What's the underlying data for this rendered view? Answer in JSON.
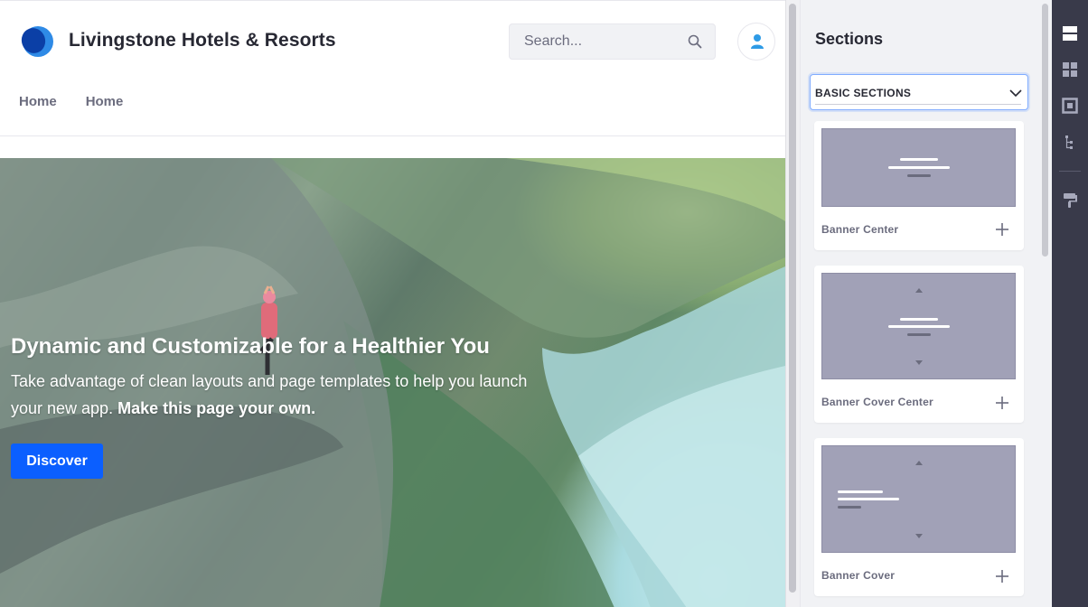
{
  "site": {
    "title": "Livingstone Hotels & Resorts",
    "brand_color": "#0b5fff"
  },
  "search": {
    "placeholder": "Search...",
    "icon": "search-icon"
  },
  "user": {
    "icon": "user-icon"
  },
  "nav": {
    "items": [
      {
        "label": "Home"
      },
      {
        "label": "Home"
      }
    ]
  },
  "hero": {
    "title": "Dynamic and Customizable for a Healthier You",
    "text_plain": "Take advantage of clean layouts and page templates to help you launch your new app. ",
    "text_bold": "Make this page your own.",
    "button_label": "Discover"
  },
  "panel": {
    "title": "Sections",
    "select_value": "BASIC SECTIONS",
    "cards": [
      {
        "label": "Banner Center"
      },
      {
        "label": "Banner Cover Center"
      },
      {
        "label": "Banner Cover"
      }
    ]
  },
  "toolbar": {
    "icons": [
      "sections-icon",
      "fragments-icon",
      "widgets-icon",
      "page-structure-icon",
      "look-and-feel-icon"
    ]
  }
}
